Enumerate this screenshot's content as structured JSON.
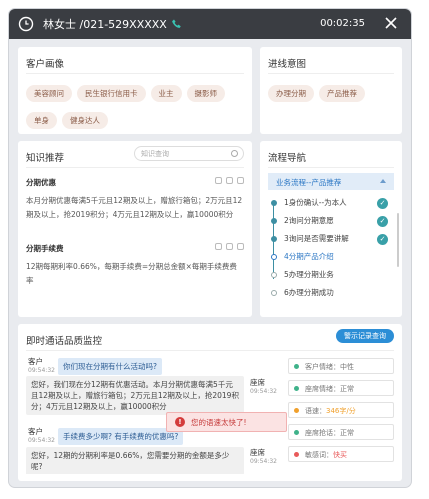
{
  "titlebar": {
    "caller_label": "林女士 /021-529XXXXX",
    "timer": "00:02:35"
  },
  "profile": {
    "title": "客户画像",
    "tags": [
      "美容顾问",
      "民生银行信用卡",
      "业主",
      "摄影师",
      "单身",
      "健身达人"
    ]
  },
  "intent": {
    "title": "进线意图",
    "tags": [
      "办理分期",
      "产品推荐"
    ]
  },
  "knowledge": {
    "title": "知识推荐",
    "search_placeholder": "知识查询",
    "items": [
      {
        "title": "分期优惠",
        "body": "本月分期优惠每满5千元且12期及以上，赠旅行箱包；2万元且12期及以上，抢2019积分；4万元且12期及以上，赢10000积分"
      },
      {
        "title": "分期手续费",
        "body": "12期每期利率0.66%，每期手续费=分期总金额×每期手续费费率"
      }
    ]
  },
  "flow": {
    "title": "流程导航",
    "group_label": "业务流程--产品推荐",
    "steps": [
      {
        "label": "1身份确认--为本人",
        "state": "done"
      },
      {
        "label": "2询问分期意愿",
        "state": "done"
      },
      {
        "label": "3询问是否需要讲解",
        "state": "done"
      },
      {
        "label": "4分期产品介绍",
        "state": "active"
      },
      {
        "label": "5办理分期业务",
        "state": "todo"
      },
      {
        "label": "6办理分期成功",
        "state": "todo"
      }
    ]
  },
  "monitor": {
    "title": "即时通话品质监控",
    "warning_button": "警示记录查询",
    "messages": [
      {
        "role": "客户",
        "time": "09:54:32",
        "text": "你们现在分期有什么活动吗?"
      },
      {
        "role": "座席",
        "time": "09:54:32",
        "text": "您好，我们现在分12期有优惠活动。本月分期优惠每满5千元且12期及以上，赠旅行箱包；2万元且12期及以上，抢2019积分；4万元且12期及以上，赢10000积分"
      },
      {
        "role": "客户",
        "time": "09:54:32",
        "text": "手续费多少啊? 有手续费的优惠吗?"
      },
      {
        "role": "座席",
        "time": "09:54:32",
        "text": "您好，12期的分期利率是0.66%，您需要分期的金额是多少呢?"
      }
    ],
    "indicators": [
      {
        "label": "客户情绪：",
        "value": "中性",
        "color": "#3fb28a"
      },
      {
        "label": "座席情绪：",
        "value": "正常",
        "color": "#3fb28a"
      },
      {
        "label": "语速：",
        "value": "346字/分",
        "color": "#f0a02c"
      },
      {
        "label": "座席抢话：",
        "value": "正常",
        "color": "#3fb28a"
      },
      {
        "label": "敏感词：",
        "value": "快买",
        "color": "#e85a5a"
      }
    ],
    "toast": "您的语速太快了!"
  }
}
